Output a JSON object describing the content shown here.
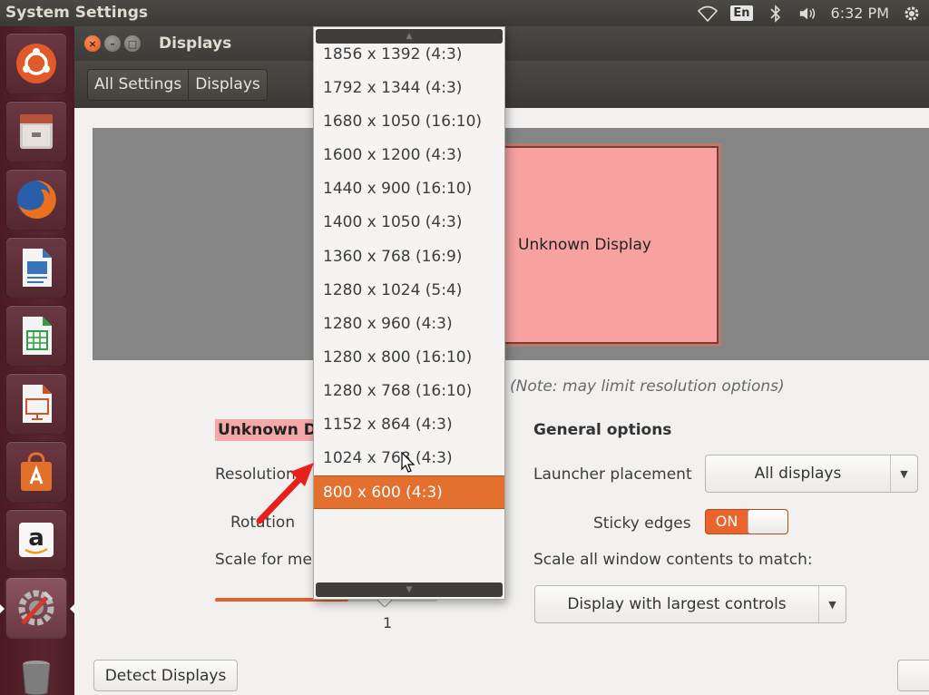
{
  "top_panel": {
    "app_title": "System Settings",
    "keyboard_layout": "En",
    "time": "6:32 PM"
  },
  "window": {
    "title": "Displays",
    "close_glyph": "×",
    "minimize_glyph": "–",
    "maximize_glyph": "□"
  },
  "breadcrumbs": [
    "All Settings",
    "Displays"
  ],
  "arrangement": {
    "monitor_label": "Unknown Display",
    "monitor_color": "#f7a1a1"
  },
  "note": "(Note: may limit resolution options)",
  "display_section": {
    "name": "Unknown Di",
    "resolution_label": "Resolution",
    "rotation_label": "Rotation",
    "scale_label": "Scale for me",
    "scale_value": "1",
    "scale_fraction": 0.6
  },
  "general_options": {
    "title": "General options",
    "launcher_placement_label": "Launcher placement",
    "launcher_placement_value": "All displays",
    "sticky_edges_label": "Sticky edges",
    "sticky_edges_state": "ON",
    "scale_all_label": "Scale all window contents to match:",
    "scale_all_value": "Display with largest controls"
  },
  "buttons": {
    "detect_displays": "Detect Displays"
  },
  "resolution_dropdown": {
    "options": [
      "1856 x 1392 (4:3)",
      "1792 x 1344 (4:3)",
      "1680 x 1050 (16:10)",
      "1600 x 1200 (4:3)",
      "1440 x 900 (16:10)",
      "1400 x 1050 (4:3)",
      "1360 x 768 (16:9)",
      "1280 x 1024 (5:4)",
      "1280 x 960 (4:3)",
      "1280 x 800 (16:10)",
      "1280 x 768 (16:10)",
      "1152 x 864 (4:3)",
      "1024 x 768 (4:3)",
      "800 x 600 (4:3)"
    ],
    "selected": "800 x 600 (4:3)",
    "scroll_up_glyph": "▲",
    "scroll_down_glyph": "▼"
  },
  "colors": {
    "accent": "#e4702f",
    "launcher_bg": "#5a2430",
    "panel_bg": "#3b3a36"
  },
  "launcher_icons": [
    "ubuntu-dash-icon",
    "files-icon",
    "firefox-icon",
    "libreoffice-writer-icon",
    "libreoffice-calc-icon",
    "libreoffice-impress-icon",
    "software-center-icon",
    "amazon-icon",
    "system-settings-icon",
    "trash-icon"
  ]
}
